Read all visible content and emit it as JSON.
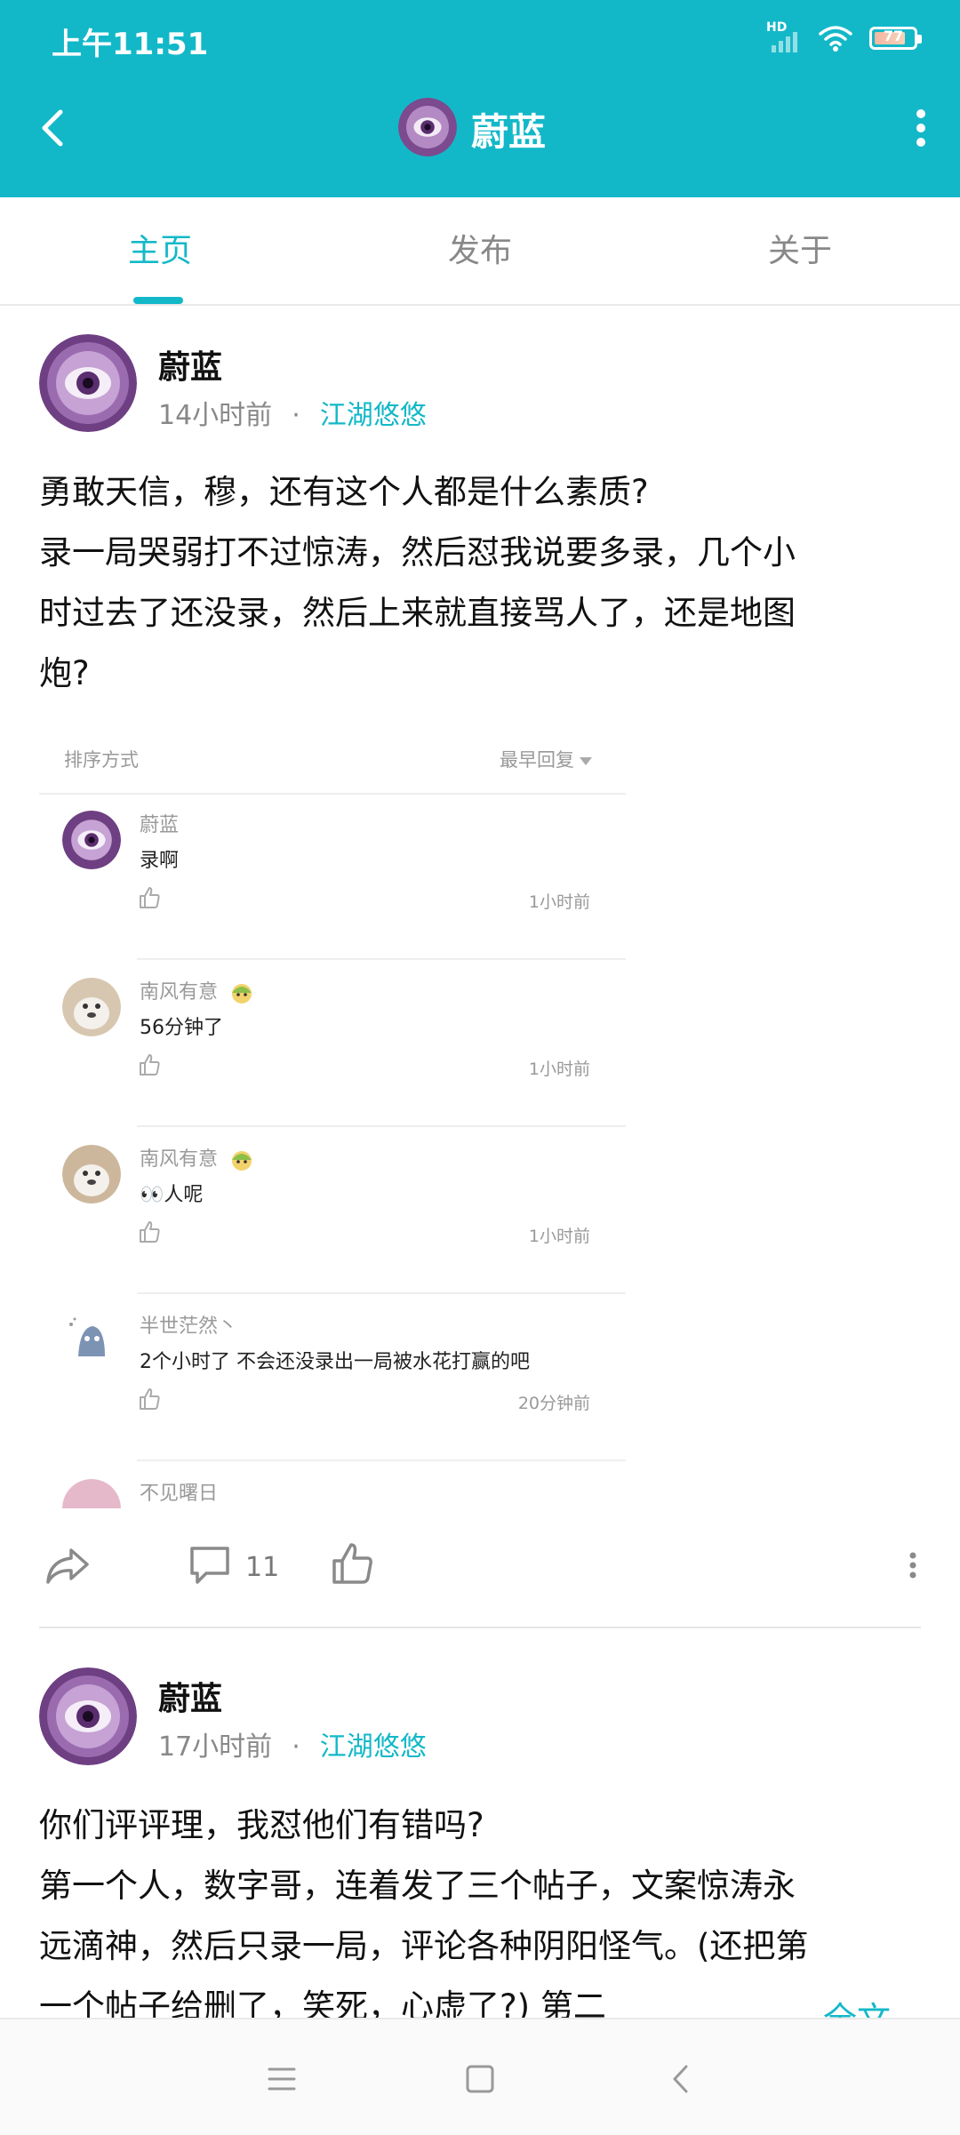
{
  "status_bar": {
    "time": "上午11:51",
    "network_label": "HD",
    "battery": "77"
  },
  "header": {
    "title": "蔚蓝"
  },
  "tabs": [
    {
      "label": "主页",
      "active": true
    },
    {
      "label": "发布",
      "active": false
    },
    {
      "label": "关于",
      "active": false
    }
  ],
  "posts": [
    {
      "author": "蔚蓝",
      "time": "14小时前",
      "separator": "·",
      "category": "江湖悠悠",
      "body_lines": [
        "勇敢天信，穆，还有这个人都是什么素质?",
        "录一局哭弱打不过惊涛，然后怼我说要多录，几个小",
        "时过去了还没录，然后上来就直接骂人了，还是地图",
        "炮?"
      ],
      "embed": {
        "sort_label": "排序方式",
        "sort_value": "最早回复",
        "comments": [
          {
            "name": "蔚蓝",
            "text": "录啊",
            "time": "1小时前"
          },
          {
            "name": "南风有意",
            "text": "56分钟了",
            "time": "1小时前"
          },
          {
            "name": "南风有意",
            "text": "👀人呢",
            "time": "1小时前"
          },
          {
            "name": "半世茫然丶",
            "text": "2个小时了  不会还没录出一局被水花打赢的吧",
            "time": "20分钟前"
          },
          {
            "name": "不见曙日",
            "text": "",
            "time": ""
          }
        ]
      },
      "comment_count": "11"
    },
    {
      "author": "蔚蓝",
      "time": "17小时前",
      "separator": "·",
      "category": "江湖悠悠",
      "body_lines": [
        "你们评评理，我怼他们有错吗?",
        "第一个人，数字哥，连着发了三个帖子，文案惊涛永",
        "远滴神，然后只录一局，评论各种阴阳怪气。(还把第",
        "一个帖子给删了，笑死，心虚了?) 第二"
      ],
      "ellipsis": "...",
      "full_text": "全文"
    }
  ],
  "colors": {
    "accent": "#13b8c8"
  }
}
